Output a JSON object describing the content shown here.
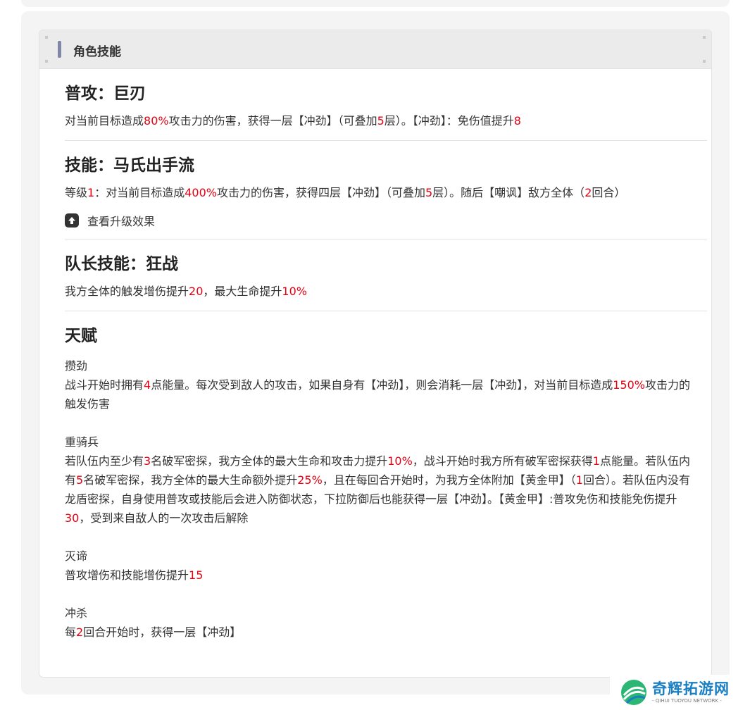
{
  "card": {
    "title": "角色技能"
  },
  "sections": {
    "normal": {
      "title": "普攻：巨刃",
      "desc": [
        {
          "t": "对当前目标造成"
        },
        {
          "t": "80%",
          "h": true
        },
        {
          "t": "攻击力的伤害，获得一层【冲劲】（可叠加"
        },
        {
          "t": "5",
          "h": true
        },
        {
          "t": "层）。【冲劲】：免伤值提升"
        },
        {
          "t": "8",
          "h": true
        }
      ]
    },
    "skill": {
      "title": "技能：马氏出手流",
      "desc": [
        {
          "t": "等级"
        },
        {
          "t": "1",
          "h": true
        },
        {
          "t": "：对当前目标造成"
        },
        {
          "t": "400%",
          "h": true
        },
        {
          "t": "攻击力的伤害，获得四层【冲劲】（可叠加"
        },
        {
          "t": "5",
          "h": true
        },
        {
          "t": "层）。随后【嘲讽】敌方全体（"
        },
        {
          "t": "2",
          "h": true
        },
        {
          "t": "回合）"
        }
      ],
      "upgrade_label": "查看升级效果"
    },
    "leader": {
      "title": "队长技能：狂战",
      "desc": [
        {
          "t": "我方全体的触发增伤提升"
        },
        {
          "t": "20",
          "h": true
        },
        {
          "t": "，最大生命提升"
        },
        {
          "t": "10%",
          "h": true
        }
      ]
    },
    "talent": {
      "title": "天赋",
      "items": [
        {
          "name": "攒劲",
          "desc": [
            {
              "t": "战斗开始时拥有"
            },
            {
              "t": "4",
              "h": true
            },
            {
              "t": "点能量。每次受到敌人的攻击，如果自身有【冲劲】，则会消耗一层【冲劲】，对当前目标造成"
            },
            {
              "t": "150%",
              "h": true
            },
            {
              "t": "攻击力的触发伤害"
            }
          ]
        },
        {
          "name": "重骑兵",
          "desc": [
            {
              "t": "若队伍内至少有"
            },
            {
              "t": "3",
              "h": true
            },
            {
              "t": "名破军密探，我方全体的最大生命和攻击力提升"
            },
            {
              "t": "10%",
              "h": true
            },
            {
              "t": "，战斗开始时我方所有破军密探获得"
            },
            {
              "t": "1",
              "h": true
            },
            {
              "t": "点能量。若队伍内有"
            },
            {
              "t": "5",
              "h": true
            },
            {
              "t": "名破军密探，我方全体的最大生命额外提升"
            },
            {
              "t": "25%",
              "h": true
            },
            {
              "t": "，且在每回合开始时，为我方全体附加【黄金甲】（"
            },
            {
              "t": "1",
              "h": true
            },
            {
              "t": "回合）。若队伍内没有龙盾密探，自身使用普攻或技能后会进入防御状态，下拉防御后也能获得一层【冲劲】。【黄金甲】:普攻免伤和技能免伤提升"
            },
            {
              "t": "30",
              "h": true
            },
            {
              "t": "，受到来自敌人的一次攻击后解除"
            }
          ]
        },
        {
          "name": "灭谛",
          "desc": [
            {
              "t": "普攻增伤和技能增伤提升"
            },
            {
              "t": "15",
              "h": true
            }
          ]
        },
        {
          "name": "冲杀",
          "desc": [
            {
              "t": "每"
            },
            {
              "t": "2",
              "h": true
            },
            {
              "t": "回合开始时，获得一层【冲劲】"
            }
          ]
        }
      ]
    }
  },
  "watermark": {
    "name": "奇辉拓游网",
    "sub": "- QIHUI TUOYOU NETWORK -",
    "colors": {
      "blue": "#1a7fc2",
      "green": "#2bb673"
    }
  },
  "colors": {
    "highlight": "#e60012",
    "accent_bar": "#7f86a6"
  }
}
